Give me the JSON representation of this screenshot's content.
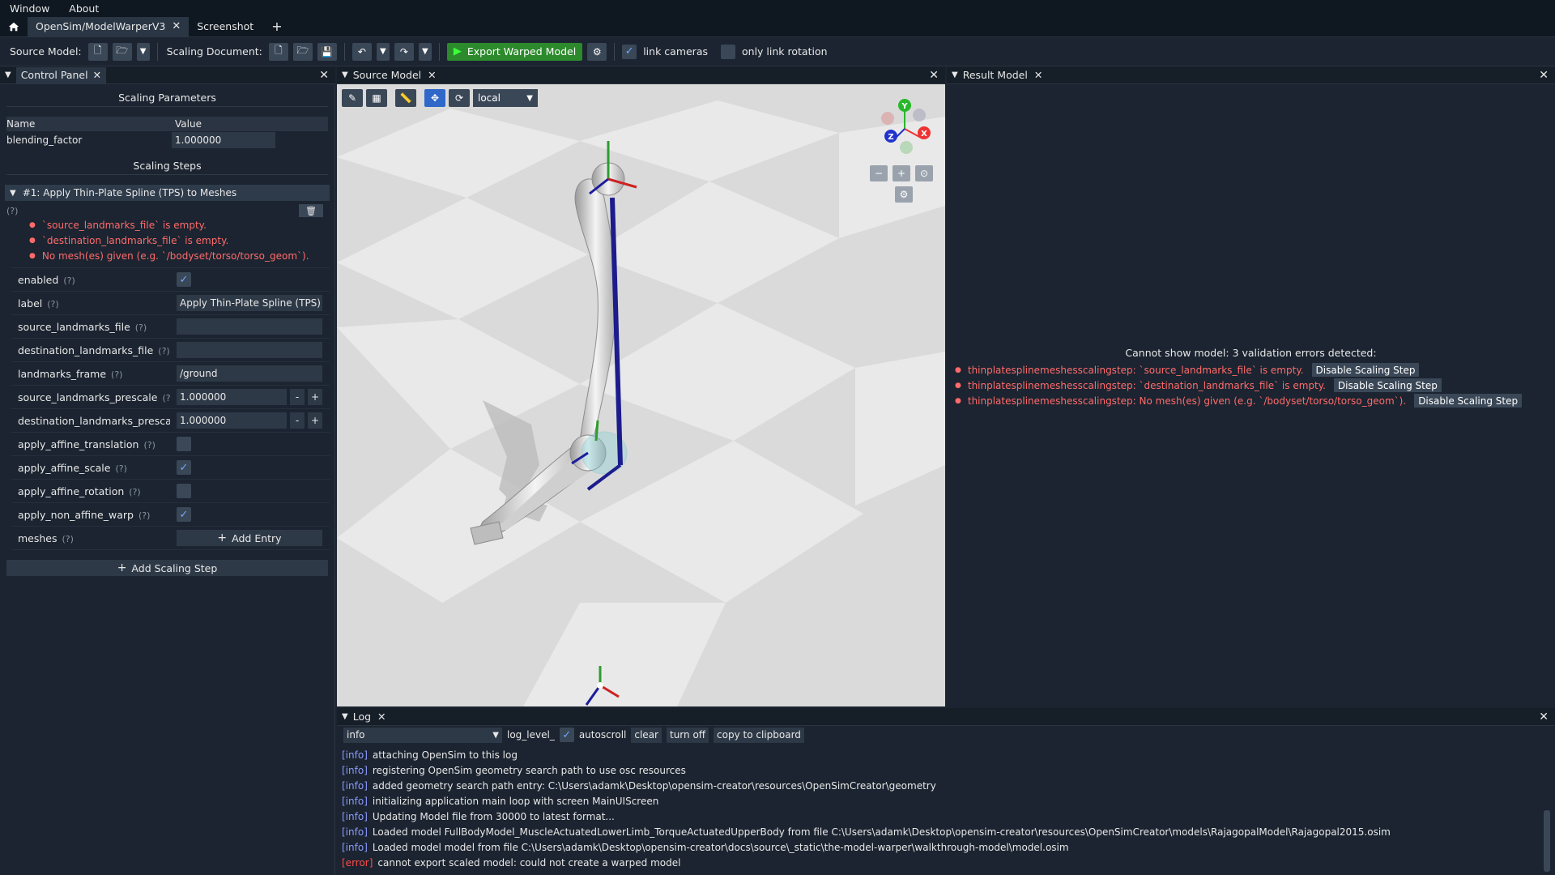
{
  "menu": [
    "Window",
    "About"
  ],
  "tabs": [
    {
      "label": "OpenSim/ModelWarperV3",
      "active": true
    },
    {
      "label": "Screenshot",
      "active": false
    }
  ],
  "toolbar": {
    "source_model_label": "Source Model:",
    "scaling_document_label": "Scaling Document:",
    "export_label": "Export Warped Model",
    "link_cameras_label": "link cameras",
    "link_cameras_checked": true,
    "only_link_rotation_label": "only link rotation",
    "only_link_rotation_checked": false
  },
  "control_panel": {
    "title": "Control Panel",
    "scaling_parameters_title": "Scaling Parameters",
    "col_name": "Name",
    "col_value": "Value",
    "params": [
      {
        "name": "blending_factor",
        "value": "1.000000"
      }
    ],
    "scaling_steps_title": "Scaling Steps",
    "step_header": "#1: Apply Thin-Plate Spline (TPS) to Meshes",
    "help_mark": "(?)",
    "errors": [
      "`source_landmarks_file` is empty.",
      "`destination_landmarks_file` is empty.",
      "No mesh(es) given (e.g. `/bodyset/torso/torso_geom`)."
    ],
    "properties": [
      {
        "name": "enabled",
        "type": "check",
        "checked": true
      },
      {
        "name": "label",
        "type": "text",
        "value": "Apply Thin-Plate Spline (TPS) to Meshes"
      },
      {
        "name": "source_landmarks_file",
        "type": "text",
        "value": ""
      },
      {
        "name": "destination_landmarks_file",
        "type": "text",
        "value": ""
      },
      {
        "name": "landmarks_frame",
        "type": "text",
        "value": "/ground"
      },
      {
        "name": "source_landmarks_prescale",
        "type": "number",
        "value": "1.000000"
      },
      {
        "name": "destination_landmarks_prescale",
        "type": "number",
        "value": "1.000000"
      },
      {
        "name": "apply_affine_translation",
        "type": "check",
        "checked": false
      },
      {
        "name": "apply_affine_scale",
        "type": "check",
        "checked": true
      },
      {
        "name": "apply_affine_rotation",
        "type": "check",
        "checked": false
      },
      {
        "name": "apply_non_affine_warp",
        "type": "check",
        "checked": true
      },
      {
        "name": "meshes",
        "type": "button",
        "value": "Add Entry"
      }
    ],
    "add_step_label": "Add Scaling Step"
  },
  "source_model": {
    "title": "Source Model",
    "frame_select": "local",
    "gizmo": {
      "y": "Y",
      "x": "X",
      "z": "Z"
    }
  },
  "result_model": {
    "title": "Result Model",
    "message": "Cannot show model: 3 validation errors detected:",
    "errors": [
      {
        "text": "thinplatesplinemeshesscalingstep: `source_landmarks_file` is empty.",
        "button": "Disable Scaling Step"
      },
      {
        "text": "thinplatesplinemeshesscalingstep: `destination_landmarks_file` is empty.",
        "button": "Disable Scaling Step"
      },
      {
        "text": "thinplatesplinemeshesscalingstep: No mesh(es) given (e.g. `/bodyset/torso/torso_geom`).",
        "button": "Disable Scaling Step"
      }
    ]
  },
  "log": {
    "title": "Log",
    "level_select": "info",
    "level_label": "log_level_",
    "autoscroll_label": "autoscroll",
    "autoscroll_checked": true,
    "clear_label": "clear",
    "turn_off_label": "turn off",
    "copy_label": "copy to clipboard",
    "lines": [
      {
        "level": "[info]",
        "text": "attaching OpenSim to this log"
      },
      {
        "level": "[info]",
        "text": "registering OpenSim geometry search path to use osc resources"
      },
      {
        "level": "[info]",
        "text": "added geometry search path entry: C:\\Users\\adamk\\Desktop\\opensim-creator\\resources\\OpenSimCreator\\geometry"
      },
      {
        "level": "[info]",
        "text": "initializing application main loop with screen MainUIScreen"
      },
      {
        "level": "[info]",
        "text": "Updating Model file from 30000 to latest format..."
      },
      {
        "level": "[info]",
        "text": "Loaded model FullBodyModel_MuscleActuatedLowerLimb_TorqueActuatedUpperBody from file C:\\Users\\adamk\\Desktop\\opensim-creator\\resources\\OpenSimCreator\\models\\RajagopalModel\\Rajagopal2015.osim"
      },
      {
        "level": "[info]",
        "text": "Loaded model model from file C:\\Users\\adamk\\Desktop\\opensim-creator\\docs\\source\\_static\\the-model-warper\\walkthrough-model\\model.osim"
      },
      {
        "level": "[error]",
        "text": "cannot export scaled model: could not create a warped model"
      }
    ]
  },
  "colors": {
    "error": "#ff6b6b",
    "info": "#8d9bff",
    "export": "#2c8a2c",
    "accent": "#2f68c9"
  }
}
